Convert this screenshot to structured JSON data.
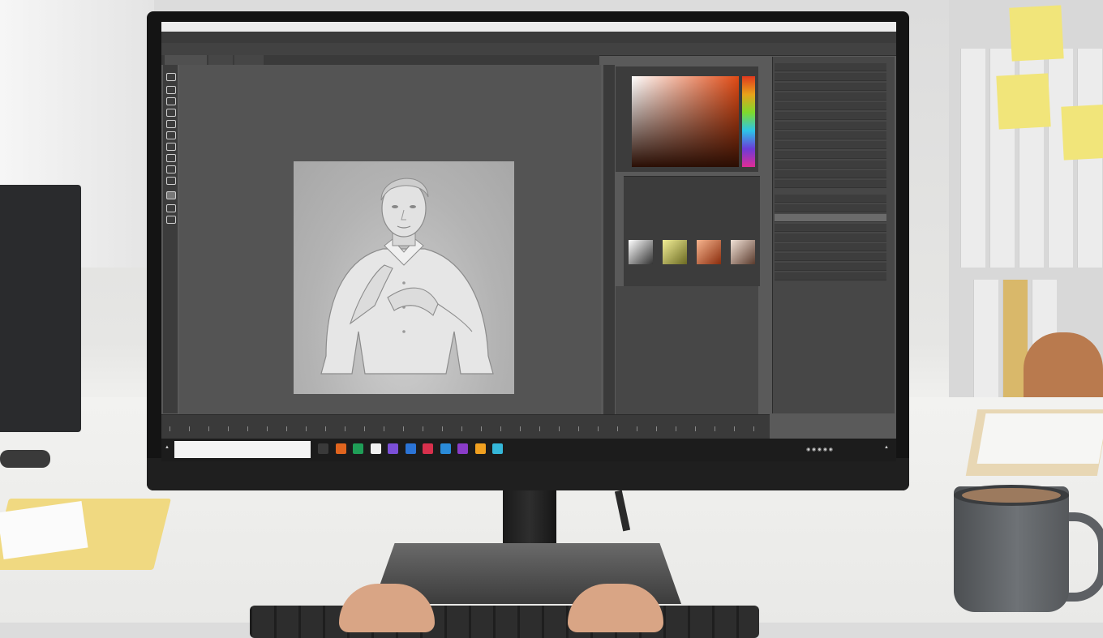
{
  "scene": {
    "description_tags": [
      "office-desk",
      "monitor",
      "photo-editor",
      "coffee-mug",
      "keyboard",
      "hands"
    ]
  },
  "screen": {
    "title_bar": "",
    "taskbar": {
      "search_placeholder": "",
      "clock_time": "",
      "clock_date": ""
    },
    "apps": [
      {
        "icon": "app-icon-1",
        "color": "#3a3a3a"
      },
      {
        "icon": "app-icon-2",
        "color": "#e0641e"
      },
      {
        "icon": "app-icon-3",
        "color": "#1f9e57"
      },
      {
        "icon": "app-icon-4",
        "color": "#f2f2f2"
      },
      {
        "icon": "app-icon-5",
        "color": "#7b4fd8"
      },
      {
        "icon": "app-icon-6",
        "color": "#2b74d6"
      },
      {
        "icon": "app-icon-7",
        "color": "#d8304c"
      },
      {
        "icon": "app-icon-8",
        "color": "#2a8bd9"
      },
      {
        "icon": "app-icon-9",
        "color": "#8a3cc8"
      },
      {
        "icon": "app-icon-10",
        "color": "#f0a020"
      },
      {
        "icon": "app-icon-11",
        "color": "#35b7d9"
      }
    ],
    "colors": {
      "ui_dark": "#3b3b3b",
      "canvas_bg": "#545454",
      "accent_orange": "#e04a14",
      "selected_layer": "#6b6b6b"
    }
  }
}
